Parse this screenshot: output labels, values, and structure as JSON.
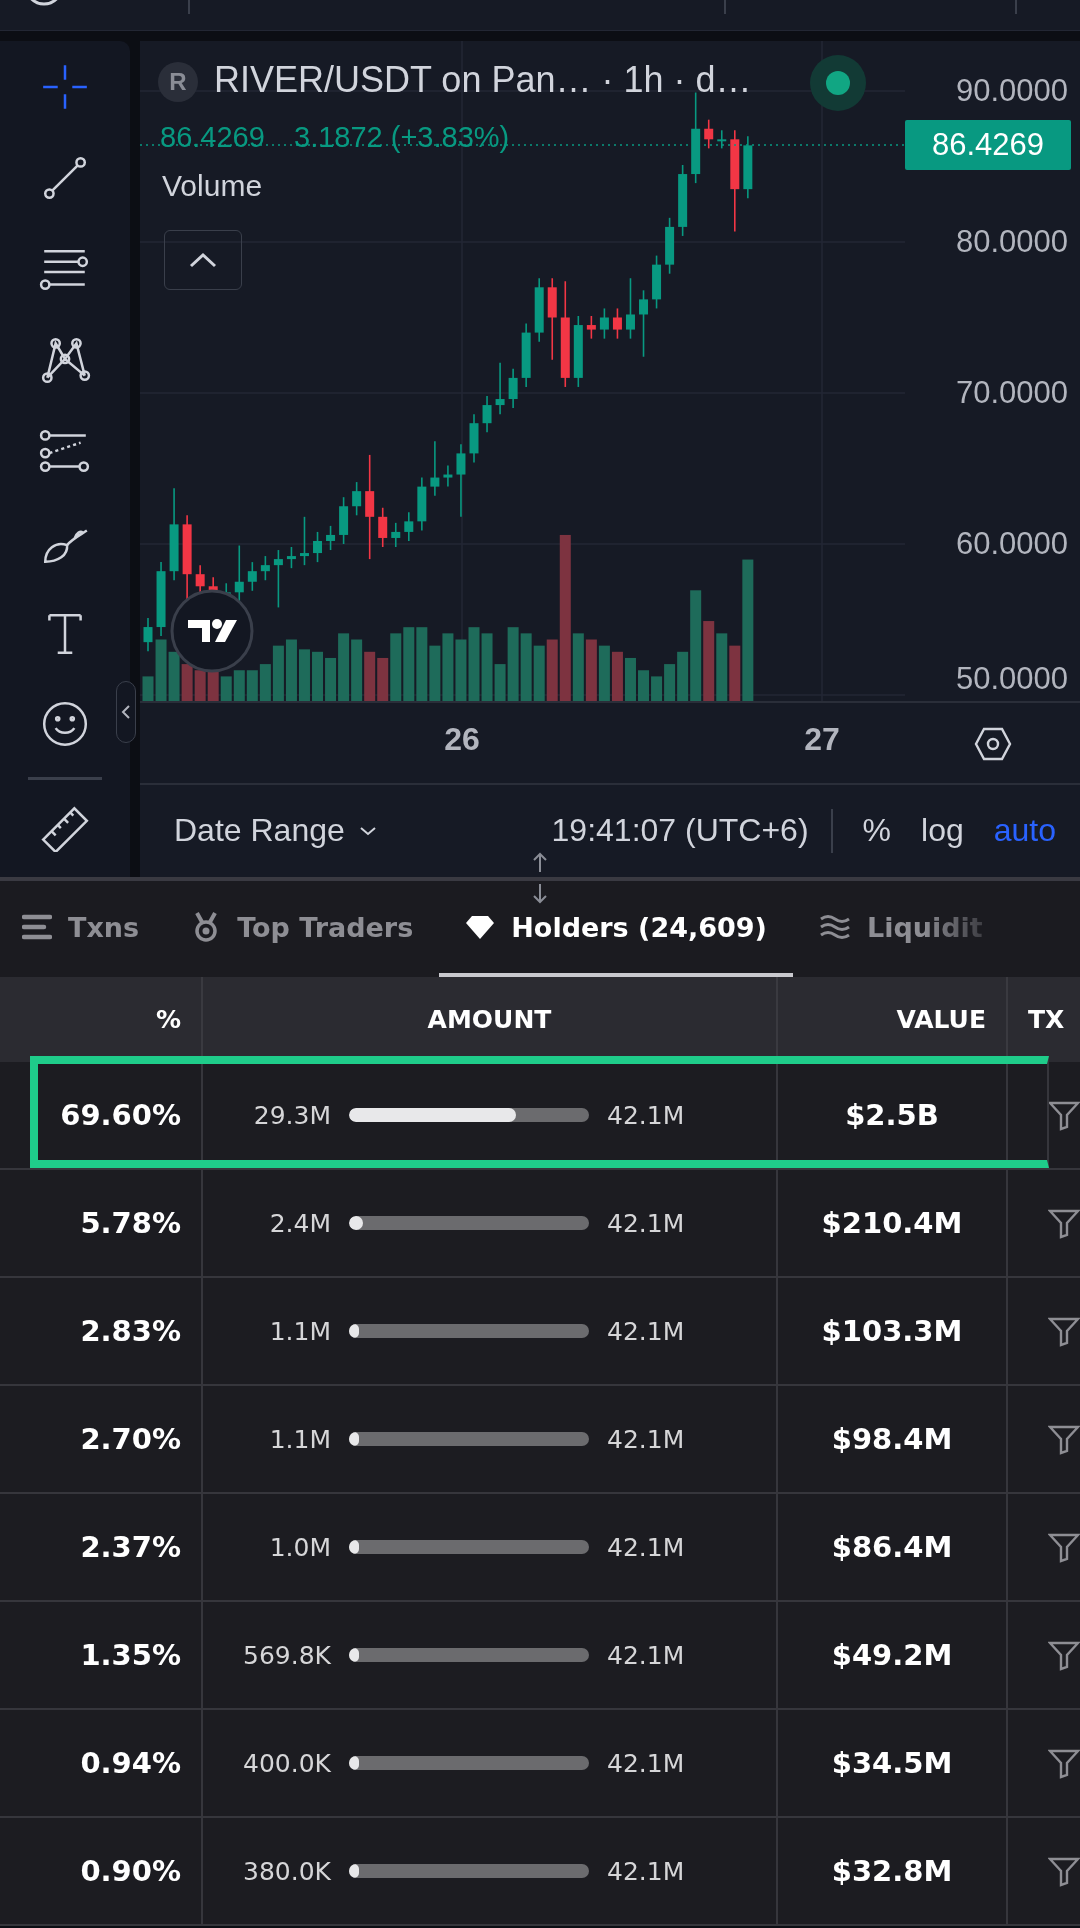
{
  "drawing_toolbar": {
    "tools": [
      {
        "kind": "crosshair",
        "selected": true
      },
      {
        "kind": "trend-line",
        "selected": false
      },
      {
        "kind": "fib",
        "selected": false
      },
      {
        "kind": "pattern",
        "selected": false
      },
      {
        "kind": "projection",
        "selected": false
      },
      {
        "kind": "brush",
        "selected": false
      },
      {
        "kind": "text",
        "selected": false
      },
      {
        "kind": "emoji",
        "selected": false
      },
      {
        "kind": "ruler",
        "selected": false
      }
    ]
  },
  "chart": {
    "symbol_badge": "R",
    "title": "RIVER/USDT on Pan… · 1h · d…",
    "live": true,
    "last_price": "86.4269",
    "change": "3.1872 (+3.83%)",
    "indicator_label": "Volume",
    "price_axis": [
      "90.0000",
      "80.0000",
      "70.0000",
      "60.0000",
      "50.0000"
    ],
    "current_price_label": "86.4269",
    "time_axis": [
      "26",
      "27"
    ],
    "bottom_bar": {
      "date_range": "Date Range",
      "clock": "19:41:07 (UTC+6)",
      "options": [
        {
          "label": "%",
          "selected": false
        },
        {
          "label": "log",
          "selected": false
        },
        {
          "label": "auto",
          "selected": true
        }
      ]
    }
  },
  "tabs": [
    {
      "kind": "list",
      "label": "Txns",
      "selected": false
    },
    {
      "kind": "medal",
      "label": "Top Traders",
      "selected": false
    },
    {
      "kind": "diamond",
      "label": "Holders (24,609)",
      "selected": true
    },
    {
      "kind": "waves",
      "label": "Liquidit",
      "selected": false
    }
  ],
  "table": {
    "columns": [
      "%",
      "AMOUNT",
      "VALUE",
      "TX"
    ],
    "rows": [
      {
        "percent": "69.60%",
        "amount": "29.3M",
        "level": 0.696,
        "max_amount": "42.1M",
        "value": "$2.5B",
        "highlighted": true
      },
      {
        "percent": "5.78%",
        "amount": "2.4M",
        "level": 0.057,
        "max_amount": "42.1M",
        "value": "$210.4M",
        "highlighted": false
      },
      {
        "percent": "2.83%",
        "amount": "1.1M",
        "level": 0.028,
        "max_amount": "42.1M",
        "value": "$103.3M",
        "highlighted": false
      },
      {
        "percent": "2.70%",
        "amount": "1.1M",
        "level": 0.027,
        "max_amount": "42.1M",
        "value": "$98.4M",
        "highlighted": false
      },
      {
        "percent": "2.37%",
        "amount": "1.0M",
        "level": 0.024,
        "max_amount": "42.1M",
        "value": "$86.4M",
        "highlighted": false
      },
      {
        "percent": "1.35%",
        "amount": "569.8K",
        "level": 0.0135,
        "max_amount": "42.1M",
        "value": "$49.2M",
        "highlighted": false
      },
      {
        "percent": "0.94%",
        "amount": "400.0K",
        "level": 0.0094,
        "max_amount": "42.1M",
        "value": "$34.5M",
        "highlighted": false
      },
      {
        "percent": "0.90%",
        "amount": "380.0K",
        "level": 0.009,
        "max_amount": "42.1M",
        "value": "$32.8M",
        "highlighted": false
      }
    ]
  }
}
